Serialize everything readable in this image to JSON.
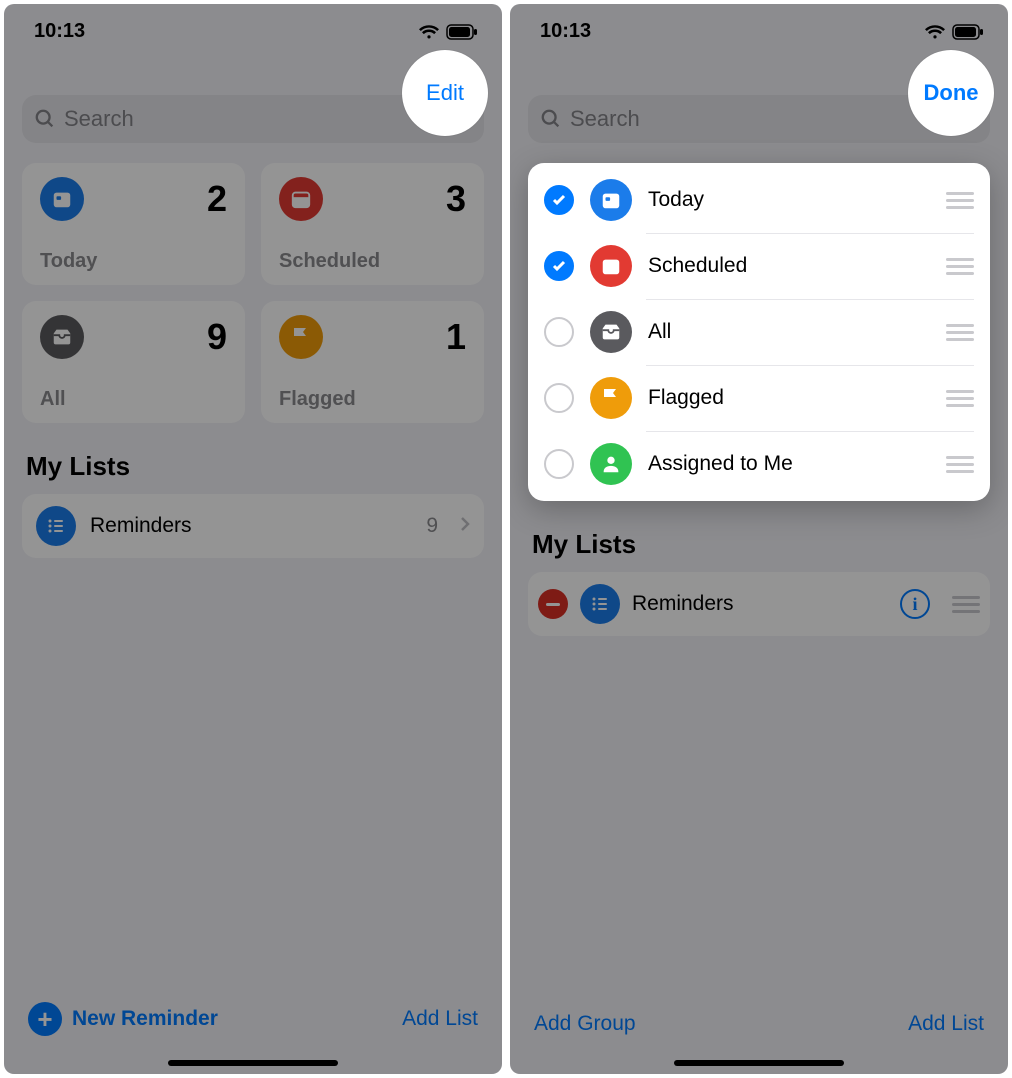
{
  "left": {
    "time": "10:13",
    "nav_button": "Edit",
    "search_placeholder": "Search",
    "tiles": [
      {
        "label": "Today",
        "count": "2",
        "color": "blue",
        "icon": "calendar-today"
      },
      {
        "label": "Scheduled",
        "count": "3",
        "color": "red",
        "icon": "calendar"
      },
      {
        "label": "All",
        "count": "9",
        "color": "dark",
        "icon": "tray"
      },
      {
        "label": "Flagged",
        "count": "1",
        "color": "orange",
        "icon": "flag"
      }
    ],
    "section": "My Lists",
    "list": {
      "name": "Reminders",
      "count": "9"
    },
    "bottom_left": "New Reminder",
    "bottom_right": "Add List"
  },
  "right": {
    "time": "10:13",
    "nav_button": "Done",
    "search_placeholder": "Search",
    "edit_rows": [
      {
        "label": "Today",
        "checked": true,
        "color": "blue",
        "icon": "calendar-today"
      },
      {
        "label": "Scheduled",
        "checked": true,
        "color": "red",
        "icon": "calendar"
      },
      {
        "label": "All",
        "checked": false,
        "color": "dark",
        "icon": "tray"
      },
      {
        "label": "Flagged",
        "checked": false,
        "color": "orange",
        "icon": "flag"
      },
      {
        "label": "Assigned to Me",
        "checked": false,
        "color": "green",
        "icon": "person"
      }
    ],
    "section": "My Lists",
    "list": {
      "name": "Reminders"
    },
    "bottom_left": "Add Group",
    "bottom_right": "Add List"
  }
}
